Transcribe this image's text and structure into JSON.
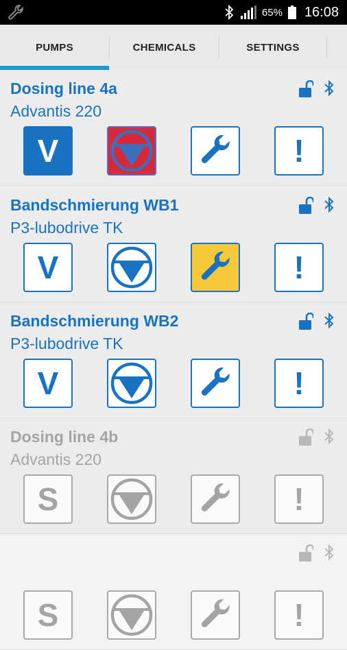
{
  "status_bar": {
    "battery_text": "65%",
    "time": "16:08",
    "icons": [
      "wrench-icon",
      "bluetooth-icon",
      "signal-icon",
      "battery-icon"
    ]
  },
  "tabs": [
    {
      "label": "PUMPS",
      "active": true
    },
    {
      "label": "CHEMICALS",
      "active": false
    },
    {
      "label": "SETTINGS",
      "active": false
    }
  ],
  "colors": {
    "accent": "#1a73c2",
    "tab_indicator": "#1c9ad6",
    "alarm_red": "#d42a3c",
    "warning_yellow": "#f6c83a",
    "disabled_gray": "#a4a4a4"
  },
  "pumps": [
    {
      "name": "Dosing line 4a",
      "model": "Advantis 220",
      "enabled": true,
      "mode_letter": "V",
      "mode_state": "active-blue",
      "level_state": "alarm-red",
      "service_state": "normal",
      "error_state": "normal"
    },
    {
      "name": "Bandschmierung WB1",
      "model": "P3-lubodrive TK",
      "enabled": true,
      "mode_letter": "V",
      "mode_state": "normal",
      "level_state": "normal",
      "service_state": "warning-yellow",
      "error_state": "normal"
    },
    {
      "name": "Bandschmierung WB2",
      "model": "P3-lubodrive TK",
      "enabled": true,
      "mode_letter": "V",
      "mode_state": "normal",
      "level_state": "normal",
      "service_state": "normal",
      "error_state": "normal"
    },
    {
      "name": "Dosing line 4b",
      "model": "Advantis 220",
      "enabled": false,
      "mode_letter": "S",
      "mode_state": "disabled",
      "level_state": "disabled",
      "service_state": "disabled",
      "error_state": "disabled"
    },
    {
      "name": "",
      "model": "",
      "enabled": false,
      "mode_letter": "S",
      "mode_state": "disabled",
      "level_state": "disabled",
      "service_state": "disabled",
      "error_state": "disabled"
    }
  ],
  "error_glyph": "!"
}
